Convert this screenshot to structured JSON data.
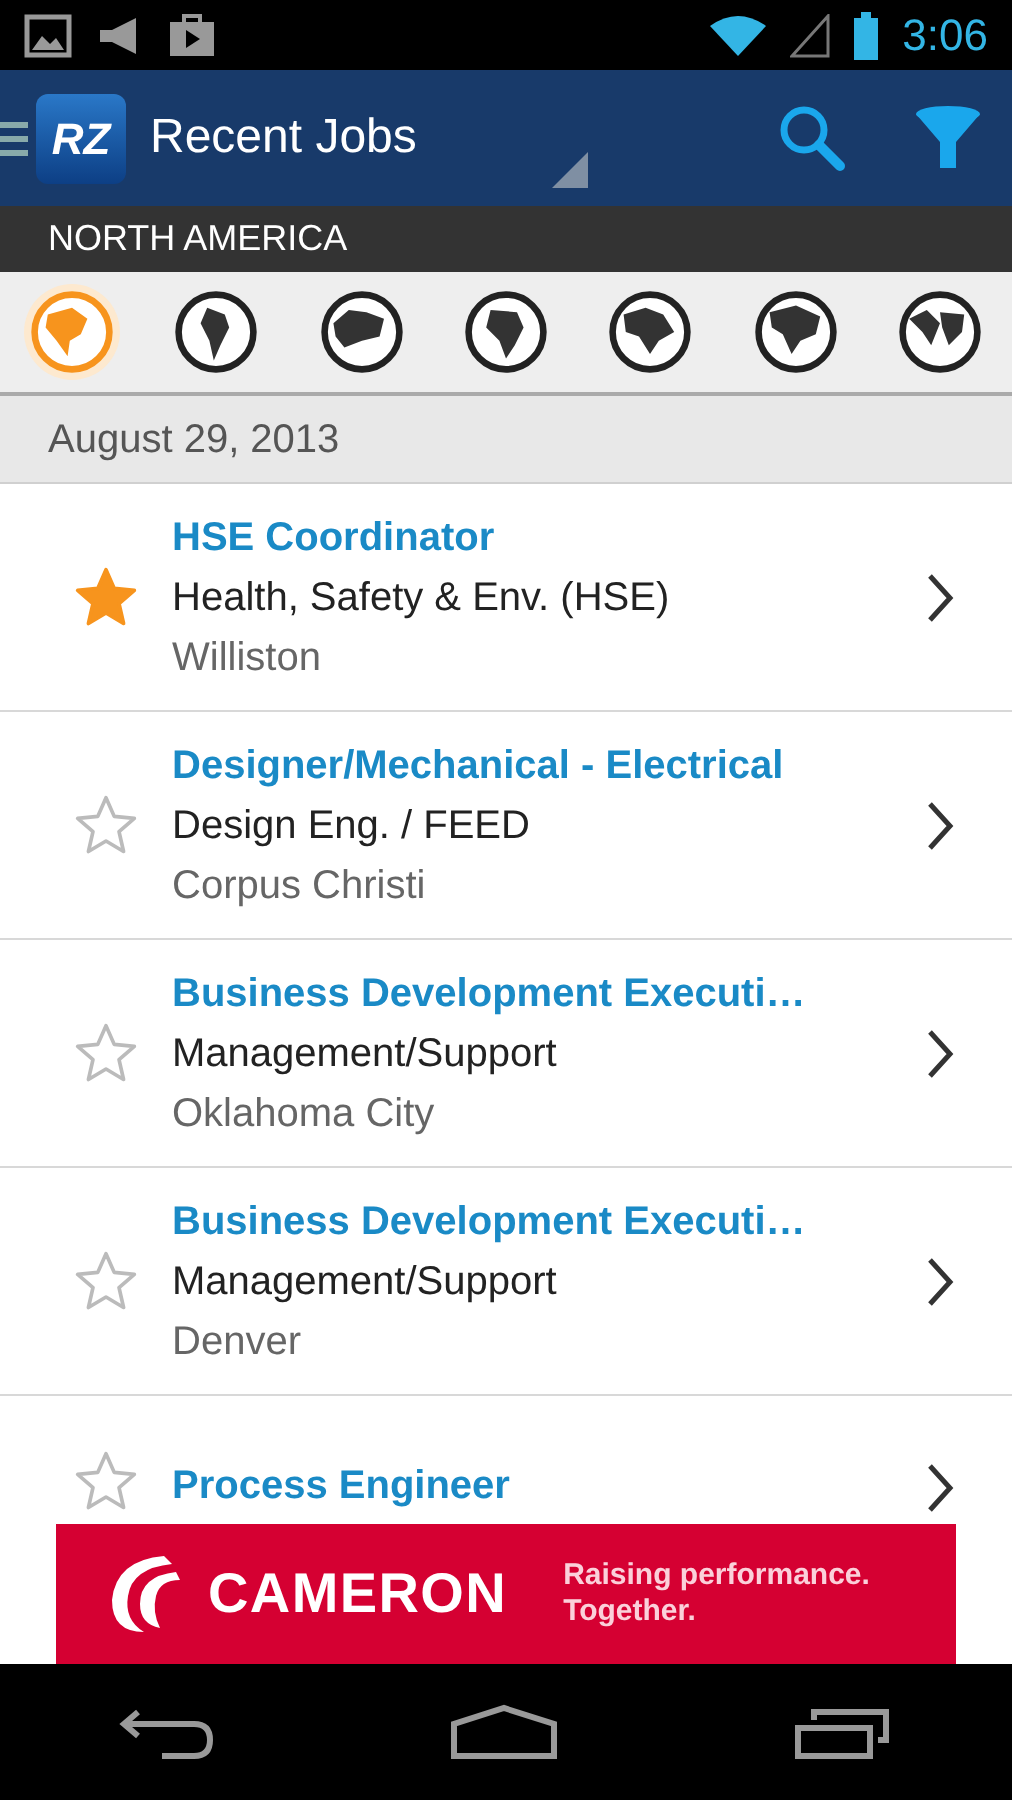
{
  "status_bar": {
    "time": "3:06"
  },
  "action_bar": {
    "logo": "RZ",
    "title": "Recent Jobs"
  },
  "region": {
    "label": "NORTH AMERICA"
  },
  "regions": [
    {
      "selected": true
    },
    {
      "selected": false
    },
    {
      "selected": false
    },
    {
      "selected": false
    },
    {
      "selected": false
    },
    {
      "selected": false
    },
    {
      "selected": false
    }
  ],
  "date_header": "August 29, 2013",
  "jobs": [
    {
      "title": "HSE Coordinator",
      "category": "Health, Safety & Env. (HSE)",
      "location": "Williston",
      "starred": true
    },
    {
      "title": "Designer/Mechanical - Electrical",
      "category": "Design Eng. / FEED",
      "location": "Corpus Christi",
      "starred": false
    },
    {
      "title": "Business Development Executi…",
      "category": "Management/Support",
      "location": "Oklahoma City",
      "starred": false
    },
    {
      "title": "Business Development Executi…",
      "category": "Management/Support",
      "location": "Denver",
      "starred": false
    },
    {
      "title": "Process Engineer",
      "starred": false
    }
  ],
  "ad": {
    "brand": "CAMERON",
    "tagline": "Raising performance. Together."
  }
}
